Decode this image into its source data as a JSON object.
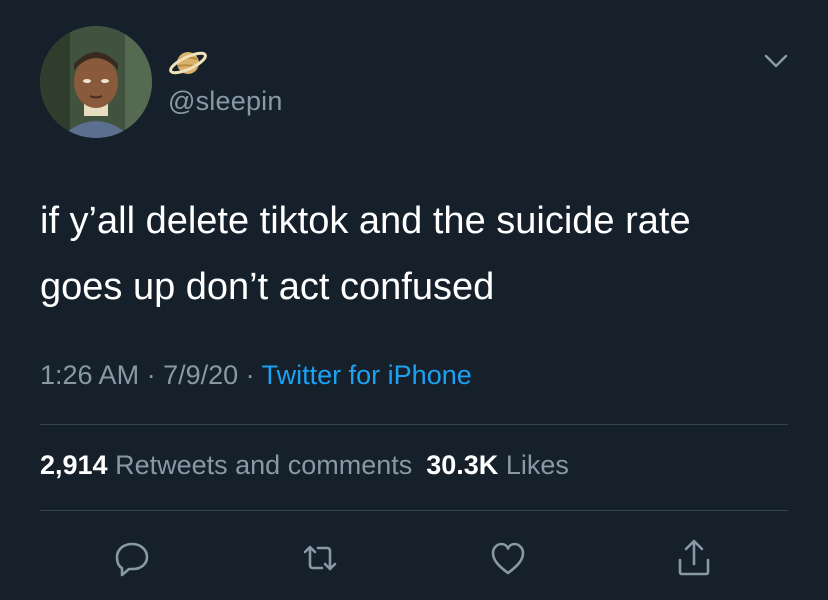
{
  "tweet": {
    "handle": "@sleepin",
    "name_emoji_icon": "ringed-planet-icon",
    "text_lines": [
      "if y’all delete tiktok and the suicide rate",
      "goes up don’t act confused"
    ],
    "time": "1:26 AM",
    "sep1": " · ",
    "date": "7/9/20",
    "sep2": " · ",
    "source": "Twitter for iPhone",
    "retweets_count": "2,914",
    "retweets_label": "Retweets and comments",
    "likes_count": "30.3K",
    "likes_label": "Likes"
  },
  "actions": [
    "reply-icon",
    "retweet-icon",
    "like-icon",
    "share-icon"
  ],
  "colors": {
    "background": "#15202b",
    "text": "#ffffff",
    "secondary": "#8899a6",
    "link": "#1da1f2",
    "divider": "#38444d"
  }
}
